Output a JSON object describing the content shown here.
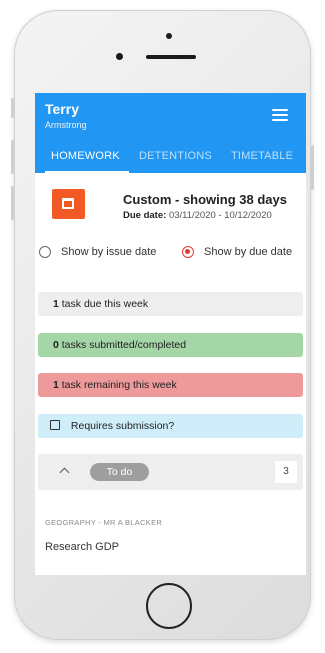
{
  "user": {
    "first_name": "Terry",
    "last_name": "Armstrong"
  },
  "tabs": [
    {
      "label": "HOMEWORK",
      "active": true
    },
    {
      "label": "DETENTIONS",
      "active": false
    },
    {
      "label": "TIMETABLE",
      "active": false
    }
  ],
  "filter": {
    "title": "Custom - showing 38 days",
    "due_label": "Due date:",
    "due_range": "03/11/2020 - 10/12/2020"
  },
  "sort_options": {
    "issue_date": "Show by issue date",
    "due_date": "Show by due date",
    "selected": "due_date"
  },
  "summary": {
    "due_count": "1",
    "due_text": "task due this week",
    "submitted_count": "0",
    "submitted_text": "tasks submitted/completed",
    "remaining_count": "1",
    "remaining_text": "task remaining this week",
    "requires_submission": "Requires submission?"
  },
  "todo": {
    "label": "To do",
    "count": "3"
  },
  "task": {
    "subject": "GEOGRAPHY - MR A BLACKER",
    "title": "Research GDP"
  },
  "colors": {
    "header": "#2196f3",
    "calendar": "#f15a24",
    "green": "#a5d6a7",
    "red": "#ef9a9a",
    "blue": "#cfeefa",
    "radio_selected": "#e53935"
  },
  "icons": [
    "menu-icon",
    "calendar-icon",
    "chevron-up-icon",
    "checkbox-icon"
  ]
}
